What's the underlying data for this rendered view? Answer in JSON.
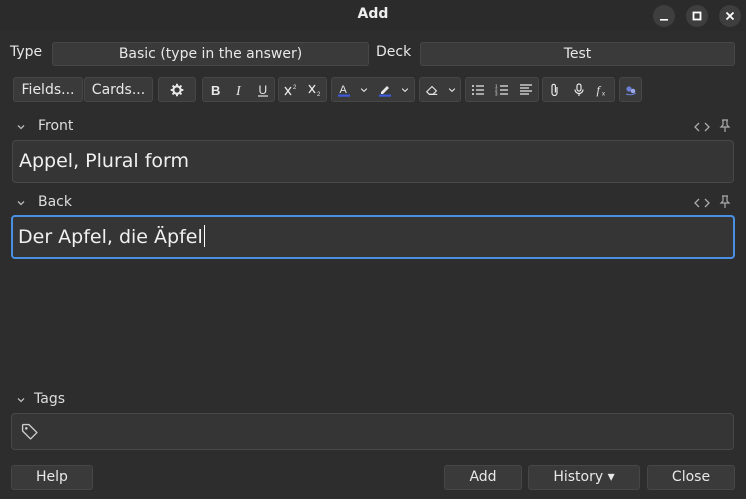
{
  "window": {
    "title": "Add"
  },
  "note": {
    "type_label": "Type",
    "type_value": "Basic (type in the answer)",
    "deck_label": "Deck",
    "deck_value": "Test"
  },
  "toolbar": {
    "fields_label": "Fields...",
    "cards_label": "Cards...",
    "text_color": "#3b5bdb",
    "highlight_color": "#3b5bdb"
  },
  "fields": [
    {
      "name": "Front",
      "value": "Appel, Plural form"
    },
    {
      "name": "Back",
      "value": "Der Apfel, die Äpfel"
    }
  ],
  "tags": {
    "label": "Tags"
  },
  "buttons": {
    "help": "Help",
    "add": "Add",
    "history": "History ▾",
    "close": "Close"
  },
  "colors": {
    "focus_border": "#4a90e2"
  }
}
